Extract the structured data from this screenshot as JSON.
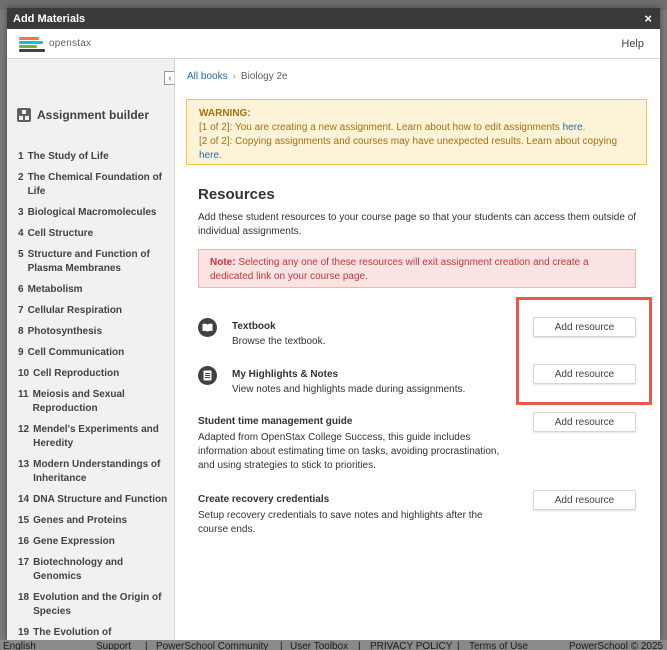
{
  "modal": {
    "title": "Add Materials",
    "close": "×"
  },
  "topnav": {
    "logo_text": "openstax",
    "help": "Help"
  },
  "breadcrumb": {
    "all_books": "All books",
    "separator": "›",
    "current": "Biology 2e"
  },
  "sidebar": {
    "collapse": "‹",
    "title": "Assignment builder",
    "chapters": [
      {
        "num": "1",
        "title": "The Study of Life"
      },
      {
        "num": "2",
        "title": "The Chemical Foundation of Life"
      },
      {
        "num": "3",
        "title": "Biological Macromolecules"
      },
      {
        "num": "4",
        "title": "Cell Structure"
      },
      {
        "num": "5",
        "title": "Structure and Function of Plasma Membranes"
      },
      {
        "num": "6",
        "title": "Metabolism"
      },
      {
        "num": "7",
        "title": "Cellular Respiration"
      },
      {
        "num": "8",
        "title": "Photosynthesis"
      },
      {
        "num": "9",
        "title": "Cell Communication"
      },
      {
        "num": "10",
        "title": "Cell Reproduction"
      },
      {
        "num": "11",
        "title": "Meiosis and Sexual Reproduction"
      },
      {
        "num": "12",
        "title": "Mendel's Experiments and Heredity"
      },
      {
        "num": "13",
        "title": "Modern Understandings of Inheritance"
      },
      {
        "num": "14",
        "title": "DNA Structure and Function"
      },
      {
        "num": "15",
        "title": "Genes and Proteins"
      },
      {
        "num": "16",
        "title": "Gene Expression"
      },
      {
        "num": "17",
        "title": "Biotechnology and Genomics"
      },
      {
        "num": "18",
        "title": "Evolution and the Origin of Species"
      },
      {
        "num": "19",
        "title": "The Evolution of"
      }
    ]
  },
  "warning": {
    "title": "WARNING:",
    "line1": "[1 of 2]: You are creating a new assignment. Learn about how to edit assignments ",
    "line1_link": "here",
    "line1_end": ".",
    "line2": "[2 of 2]: Copying assignments and courses may have unexpected results. Learn about copying ",
    "line2_link": "here",
    "line2_end": "."
  },
  "resources": {
    "title": "Resources",
    "description": "Add these student resources to your course page so that your students can access them outside of individual assignments.",
    "note_label": "Note:",
    "note_text": " Selecting any one of these resources will exit assignment creation and create a dedicated link on your course page.",
    "items": [
      {
        "title": "Textbook",
        "description": "Browse the textbook.",
        "button": "Add resource",
        "icon": "book-icon"
      },
      {
        "title": "My Highlights & Notes",
        "description": "View notes and highlights made during assignments.",
        "button": "Add resource",
        "icon": "notes-icon"
      },
      {
        "title": "Student time management guide",
        "description": "Adapted from OpenStax College Success, this guide includes information about estimating time on tasks, avoiding procrastination, and using strategies to stick to priorities.",
        "button": "Add resource"
      },
      {
        "title": "Create recovery credentials",
        "description": "Setup recovery credentials to save notes and highlights after the course ends.",
        "button": "Add resource"
      }
    ]
  },
  "footer": {
    "items": [
      "English",
      "Support",
      "|",
      "PowerSchool Community",
      "|",
      "User Toolbox",
      "|",
      "PRIVACY POLICY",
      "|",
      "Terms of Use",
      "PowerSchool © 2025"
    ]
  },
  "colors": {
    "accent": "#1e6da7",
    "warning_bg": "#fdf3d9",
    "note_bg": "#f9e3e3",
    "highlight": "#e65a50"
  }
}
